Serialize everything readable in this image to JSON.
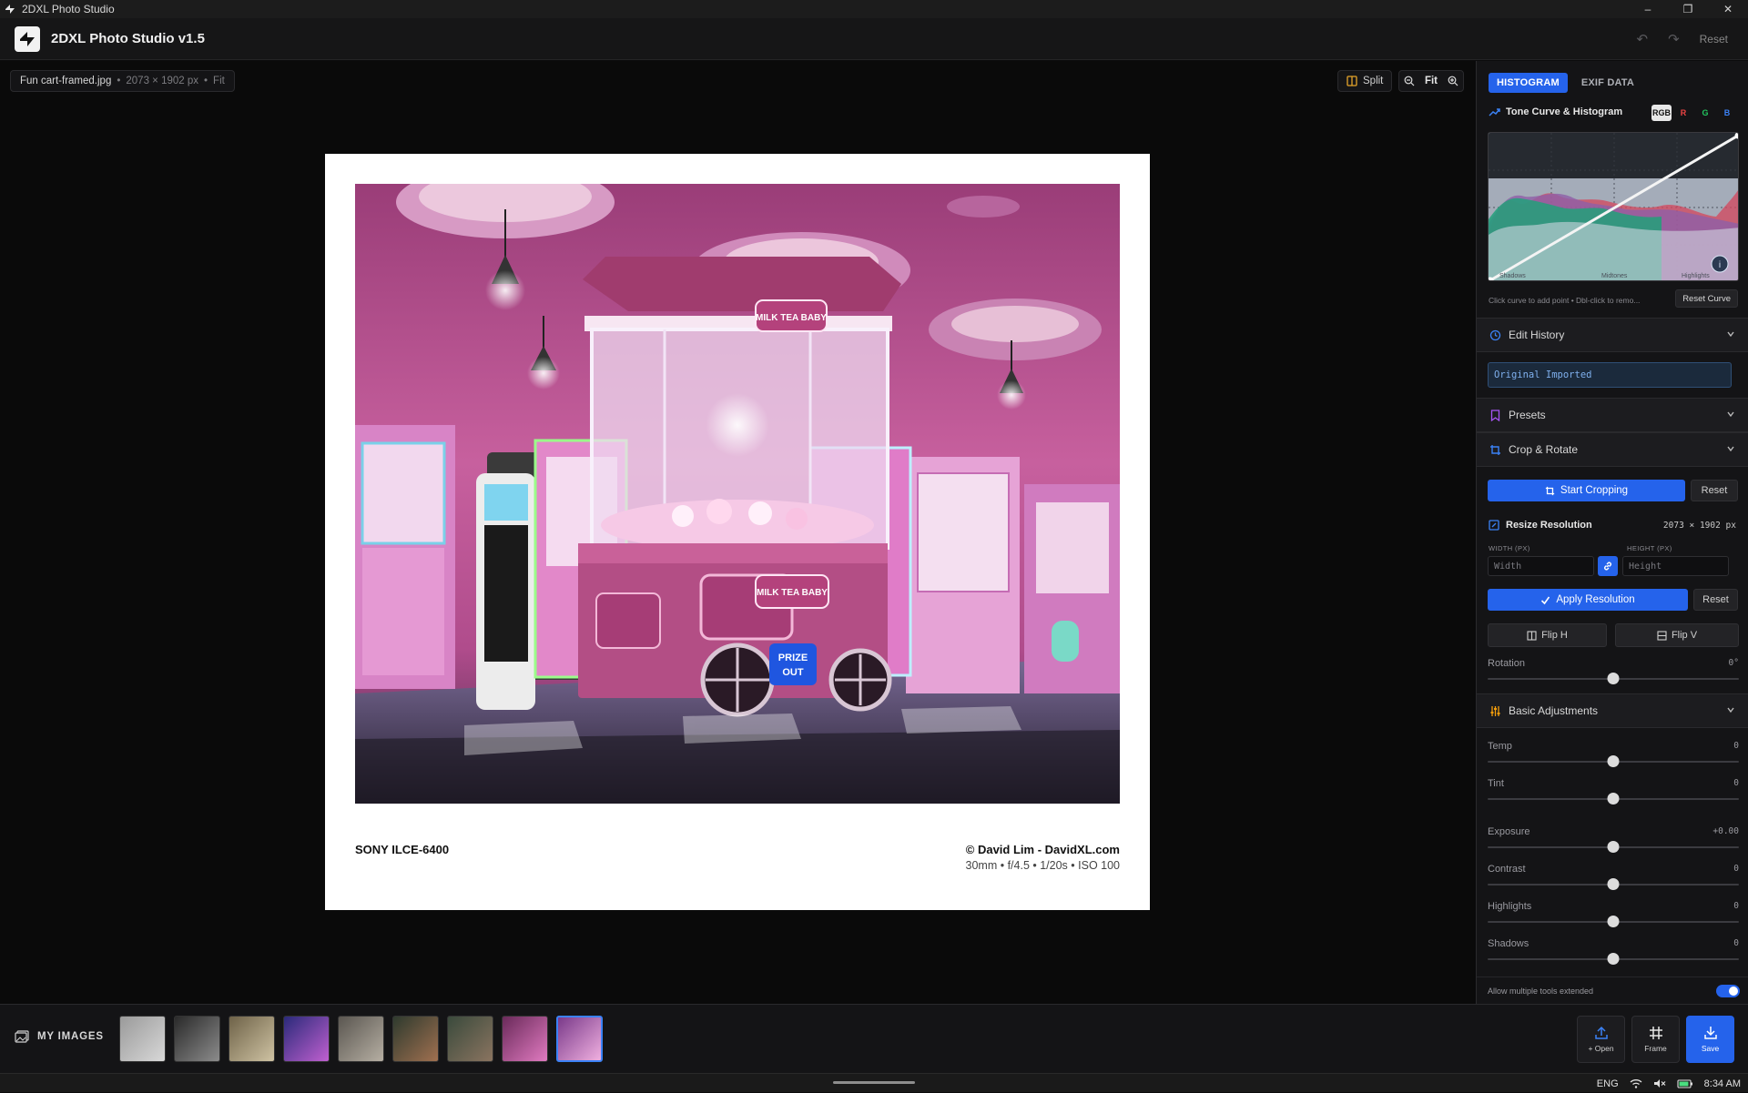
{
  "window": {
    "title": "2DXL Photo Studio",
    "controls": [
      "–",
      "❐",
      "✕"
    ]
  },
  "app": {
    "title": "2DXL Photo Studio v1.5",
    "reset_label": "Reset"
  },
  "canvas": {
    "file_name": "Fun cart-framed.jpg",
    "file_dims": "2073 × 1902 px",
    "file_zoom": "Fit",
    "split_label": "Split",
    "zoom_label": "Fit"
  },
  "frame": {
    "camera": "SONY ILCE-6400",
    "copyright": "© David Lim - DavidXL.com",
    "exposure_info": "30mm • f/4.5 • 1/20s • ISO 100",
    "photo_text_1": "MILK TEA BABY",
    "photo_text_2": "PRIZE OUT"
  },
  "panel": {
    "tabs": [
      {
        "label": "HISTOGRAM",
        "active": true
      },
      {
        "label": "EXIF DATA",
        "active": false
      }
    ],
    "tone_curve": {
      "title": "Tone Curve & Histogram",
      "channels": [
        {
          "label": "RGB",
          "color": "#111111",
          "active": true
        },
        {
          "label": "R",
          "color": "#ef4444",
          "active": false
        },
        {
          "label": "G",
          "color": "#22c55e",
          "active": false
        },
        {
          "label": "B",
          "color": "#3b82f6",
          "active": false
        }
      ],
      "zone_labels": [
        "Shadows",
        "Midtones",
        "Highlights"
      ],
      "hint": "Click curve to add point • Dbl-click to remo...",
      "reset_label": "Reset Curve"
    },
    "edit_history": {
      "title": "Edit History",
      "items": [
        "Original Imported"
      ]
    },
    "presets": {
      "title": "Presets"
    },
    "crop_rotate": {
      "title": "Crop & Rotate",
      "start_label": "Start Cropping",
      "reset_label": "Reset",
      "resize_title": "Resize Resolution",
      "resize_dims": "2073 × 1902 px",
      "width_label": "WIDTH (PX)",
      "height_label": "HEIGHT (PX)",
      "width_placeholder": "Width",
      "height_placeholder": "Height",
      "apply_label": "Apply Resolution",
      "apply_reset_label": "Reset",
      "flip_h_label": "Flip H",
      "flip_v_label": "Flip V",
      "rotation_label": "Rotation",
      "rotation_value": "0°",
      "rotation_level": 0.5
    },
    "basic": {
      "title": "Basic Adjustments",
      "sliders": [
        {
          "label": "Temp",
          "value": "0",
          "level": 0.5
        },
        {
          "label": "Tint",
          "value": "0",
          "level": 0.5
        },
        {
          "label": "Exposure",
          "value": "+0.00",
          "level": 0.5
        },
        {
          "label": "Contrast",
          "value": "0",
          "level": 0.5
        },
        {
          "label": "Highlights",
          "value": "0",
          "level": 0.5
        },
        {
          "label": "Shadows",
          "value": "0",
          "level": 0.5
        }
      ]
    },
    "footer": {
      "toggle_label": "Allow multiple tools extended",
      "toggle_on": true
    }
  },
  "filmstrip": {
    "title": "MY IMAGES",
    "thumbs": [
      {
        "name": "bird",
        "colors": [
          "#9a9a9a",
          "#d8d8d8"
        ]
      },
      {
        "name": "portrait",
        "colors": [
          "#2a2a2a",
          "#8c8c8c"
        ]
      },
      {
        "name": "aircraft",
        "colors": [
          "#6e6248",
          "#cfc3a3"
        ]
      },
      {
        "name": "arcade",
        "colors": [
          "#2a2a7a",
          "#c060d0"
        ]
      },
      {
        "name": "jets",
        "colors": [
          "#5a5650",
          "#b6afa3"
        ]
      },
      {
        "name": "truck",
        "colors": [
          "#2e3a2e",
          "#a07050"
        ]
      },
      {
        "name": "truck2",
        "colors": [
          "#3a4a3c",
          "#8a7460"
        ]
      },
      {
        "name": "arcade-pink",
        "colors": [
          "#6a2a5a",
          "#e07ac0"
        ]
      },
      {
        "name": "fun-cart",
        "colors": [
          "#7a3a8a",
          "#f0b0e0"
        ],
        "selected": true
      }
    ],
    "actions": [
      {
        "label": "+ Open",
        "icon": "upload-icon"
      },
      {
        "label": "Frame",
        "icon": "frame-icon"
      },
      {
        "label": "Save",
        "icon": "download-icon",
        "primary": true
      }
    ]
  },
  "taskbar": {
    "lang": "ENG",
    "time": "8:34 AM"
  }
}
